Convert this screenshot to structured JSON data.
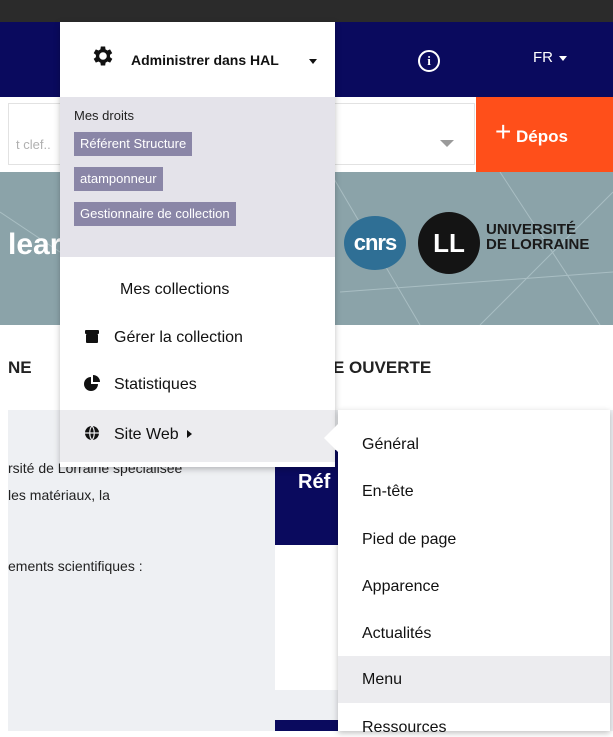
{
  "header": {
    "info_glyph": "i",
    "lang_label": "FR"
  },
  "search": {
    "placeholder": "t clef..",
    "deposit_label": "Dépos",
    "deposit_plus": "+"
  },
  "banner": {
    "title_fragment": "lear",
    "cnrs_text": "cnrs",
    "lorraine_logo_letters": "LL",
    "lorraine_line_1": "UNIVERSITÉ",
    "lorraine_line_2": "DE LORRAINE"
  },
  "nav": {
    "item_left": "NE",
    "item_right": "E OUVERTE"
  },
  "content": {
    "line_1": "rsité de Lorraine spécialisée",
    "line_2": " les matériaux, la",
    "line_3": "ements scientifiques :",
    "card_title": "Réf"
  },
  "admin_menu": {
    "label": "Administrer dans HAL",
    "rights_title": "Mes droits",
    "roles": [
      "Référent Structure",
      "atamponneur",
      "Gestionnaire de collection"
    ],
    "items": {
      "collections": "Mes collections",
      "gerer": "Gérer la collection",
      "stats": "Statistiques",
      "site_web": "Site Web"
    }
  },
  "site_web_submenu": {
    "items": [
      "Général",
      "En-tête",
      "Pied de page",
      "Apparence",
      "Actualités",
      "Menu",
      "Ressources"
    ],
    "highlighted": "Menu"
  },
  "colors": {
    "header_navy": "#0a0a5e",
    "deposit_orange": "#ff4f1a",
    "role_badge": "#8a86a7",
    "rights_panel": "#e4e3ea",
    "hover_row": "#ececef"
  }
}
